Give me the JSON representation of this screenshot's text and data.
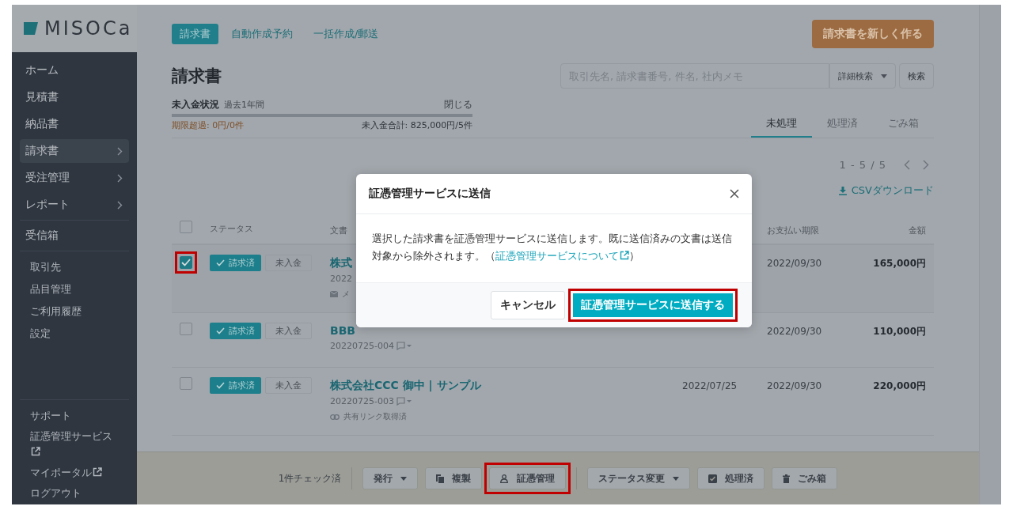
{
  "logo": {
    "text": "MISOCa"
  },
  "sidebar": {
    "main_items": [
      {
        "label": "ホーム",
        "chevron": false,
        "selected": false
      },
      {
        "label": "見積書",
        "chevron": false,
        "selected": false
      },
      {
        "label": "納品書",
        "chevron": false,
        "selected": false
      },
      {
        "label": "請求書",
        "chevron": true,
        "selected": true
      },
      {
        "label": "受注管理",
        "chevron": true,
        "selected": false
      },
      {
        "label": "レポート",
        "chevron": true,
        "selected": false
      },
      {
        "label": "受信箱",
        "chevron": false,
        "selected": false
      }
    ],
    "sub_items": [
      "取引先",
      "品目管理",
      "ご利用履歴",
      "設定"
    ],
    "footer_items": [
      {
        "label": "サポート",
        "external": false
      },
      {
        "label": "証憑管理サービス",
        "external": true
      },
      {
        "label": "マイポータル",
        "external": true
      },
      {
        "label": "ログアウト",
        "external": false
      }
    ]
  },
  "top_tabs": [
    {
      "label": "請求書",
      "selected": true
    },
    {
      "label": "自動作成予約",
      "selected": false
    },
    {
      "label": "一括作成/郵送",
      "selected": false
    }
  ],
  "create_button": "請求書を新しく作る",
  "page_title": "請求書",
  "search": {
    "placeholder": "取引先名, 請求書番号, 件名, 社内メモ",
    "advanced": "詳細検索",
    "button": "検索"
  },
  "summary": {
    "title": "未入金状況",
    "period": "過去1年間",
    "close": "閉じる",
    "overdue": "期限超過: 0円/0件",
    "total": "未入金合計: 825,000円/5件"
  },
  "status_tabs": [
    {
      "label": "未処理",
      "selected": true
    },
    {
      "label": "処理済",
      "selected": false
    },
    {
      "label": "ごみ箱",
      "selected": false
    }
  ],
  "pagination": "1 - 5 / 5",
  "csv_link": "CSVダウンロード",
  "table": {
    "select_all_checked": false,
    "columns": [
      "ステータス",
      "文書",
      "お支払い期限",
      "金額"
    ],
    "rows": [
      {
        "checked": true,
        "highlighted": true,
        "status": "請求済",
        "payment": "未入金",
        "title": "株式",
        "number": "2022",
        "note": {
          "kind": "mail",
          "text": "メ"
        },
        "due_date": "2022/09/30",
        "amount": "165,000円"
      },
      {
        "checked": false,
        "highlighted": false,
        "status": "請求済",
        "payment": "未入金",
        "title": "BBB",
        "number": "20220725-004",
        "note": null,
        "due_date": "2022/09/30",
        "amount": "110,000円"
      },
      {
        "checked": false,
        "highlighted": false,
        "status": "請求済",
        "payment": "未入金",
        "title": "株式会社CCC 御中 | サンプル",
        "number": "20220725-003",
        "note": {
          "kind": "link",
          "text": "共有リンク取得済"
        },
        "issue_date": "2022/07/25",
        "due_date": "2022/09/30",
        "amount": "220,000円"
      }
    ]
  },
  "bottom_bar": {
    "count": "1件チェック済",
    "button_groups": [
      [
        {
          "kind": "dropdown",
          "label": "発行",
          "highlighted": false
        },
        {
          "kind": "copy",
          "label": "複製",
          "highlighted": false
        },
        {
          "kind": "certificate",
          "label": "証憑管理",
          "highlighted": true
        }
      ],
      [
        {
          "kind": "dropdown",
          "label": "ステータス変更",
          "highlighted": false
        },
        {
          "kind": "check",
          "label": "処理済",
          "highlighted": false
        },
        {
          "kind": "trash",
          "label": "ごみ箱",
          "highlighted": false
        }
      ]
    ]
  },
  "modal": {
    "title": "証憑管理サービスに送信",
    "body": "選択した請求書を証憑管理サービスに送信します。既に送信済みの文書は送信対象から除外されます。（",
    "link": "証憑管理サービスについて",
    "body_end": "）",
    "cancel": "キャンセル",
    "confirm": "証憑管理サービスに送信する",
    "confirm_highlighted": true
  }
}
